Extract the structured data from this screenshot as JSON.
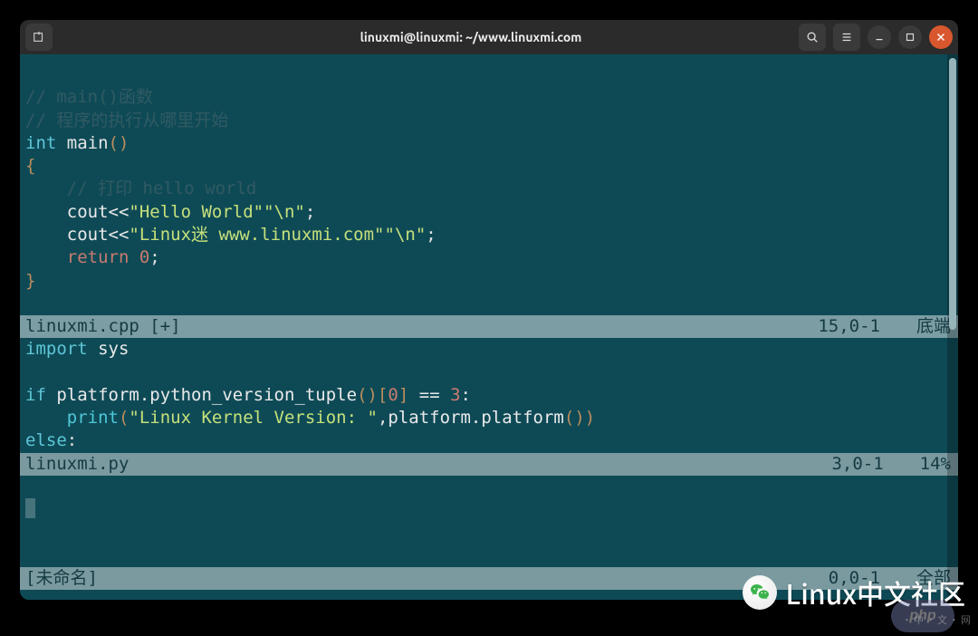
{
  "titlebar": {
    "title": "linuxmi@linuxmi: ~/www.linuxmi.com"
  },
  "pane1": {
    "comments": {
      "c1": "// main()函数",
      "c2": "// 程序的执行从哪里开始",
      "c3": "    // 打印 hello world"
    },
    "code": {
      "int": "int",
      "main_sig": " main",
      "paren": "()",
      "brace_open": "{",
      "cout1_a": "    cout<<",
      "str1": "\"Hello World\"",
      "str1b": "\"\\n\"",
      "semi": ";",
      "cout2_a": "    cout<<",
      "str2": "\"Linux迷 www.linuxmi.com\"",
      "str2b": "\"\\n\"",
      "return_kw": "    return",
      "return_val": " 0",
      "brace_close": "}"
    },
    "status": {
      "name": "linuxmi.cpp [+]",
      "pos": "15,0-1",
      "end": "底端"
    }
  },
  "pane2": {
    "code": {
      "import": "import",
      "sys": " sys",
      "if": "if",
      "cond_a": " platform.python_version_tuple",
      "cond_paren": "()",
      "idx_open": "[",
      "idx_num": "0",
      "idx_close": "]",
      "eq": " == ",
      "three": "3",
      "colon1": ":",
      "print_indent": "    print",
      "print_paren_open": "(",
      "pstr": "\"Linux Kernel Version: \"",
      "comma": ",",
      "plat_call": "platform.platform",
      "pp_paren": "()",
      "print_paren_close": ")",
      "else": "else",
      "colon2": ":"
    },
    "status": {
      "name": "linuxmi.py",
      "pos": "3,0-1",
      "end": "14%"
    }
  },
  "pane3": {
    "status": {
      "name": "[未命名]",
      "pos": "0,0-1",
      "end": "全部"
    }
  },
  "watermark": {
    "text": "Linux中文社区"
  },
  "phpbadge": "php",
  "cnlabel": "・中・文・网"
}
